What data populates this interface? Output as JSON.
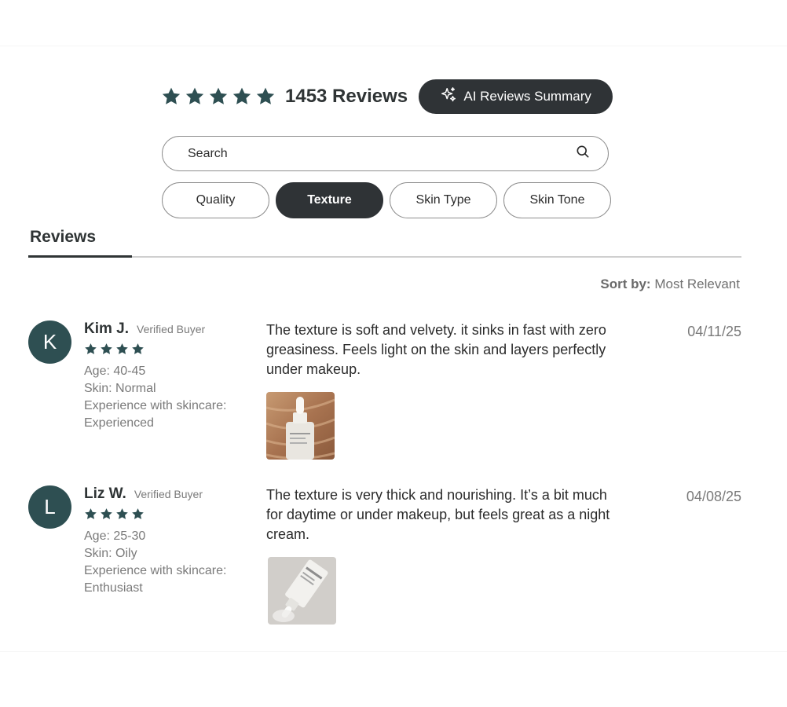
{
  "summary": {
    "rating_stars": 5,
    "total_reviews": "1453 Reviews",
    "ai_button": "AI Reviews Summary"
  },
  "search": {
    "placeholder": "Search"
  },
  "filters": [
    {
      "label": "Quality",
      "active": false
    },
    {
      "label": "Texture",
      "active": true
    },
    {
      "label": "Skin Type",
      "active": false
    },
    {
      "label": "Skin Tone",
      "active": false
    }
  ],
  "tabs": {
    "reviews": "Reviews"
  },
  "sort": {
    "label": "Sort by:",
    "value": "Most Relevant"
  },
  "colors": {
    "accent": "#2e4f52",
    "dark": "#2f3336",
    "muted": "#7a7a7a"
  },
  "reviews": [
    {
      "initial": "K",
      "name": "Kim J.",
      "badge": "Verified Buyer",
      "stars": 4,
      "age": "Age: 40-45",
      "skin": "Skin: Normal",
      "experience": "Experience with skincare: Experienced",
      "text": "The texture is soft and velvety. it sinks in fast with zero greasiness. Feels light on the skin and layers perfectly under makeup.",
      "date": "04/11/25"
    },
    {
      "initial": "L",
      "name": "Liz W.",
      "badge": "Verified Buyer",
      "stars": 4,
      "age": "Age: 25-30",
      "skin": "Skin: Oily",
      "experience": "Experience with skincare: Enthusiast",
      "text": "The texture is very thick and nourishing. It’s a bit much for daytime or under makeup, but feels great as a night cream.",
      "date": "04/08/25"
    }
  ]
}
